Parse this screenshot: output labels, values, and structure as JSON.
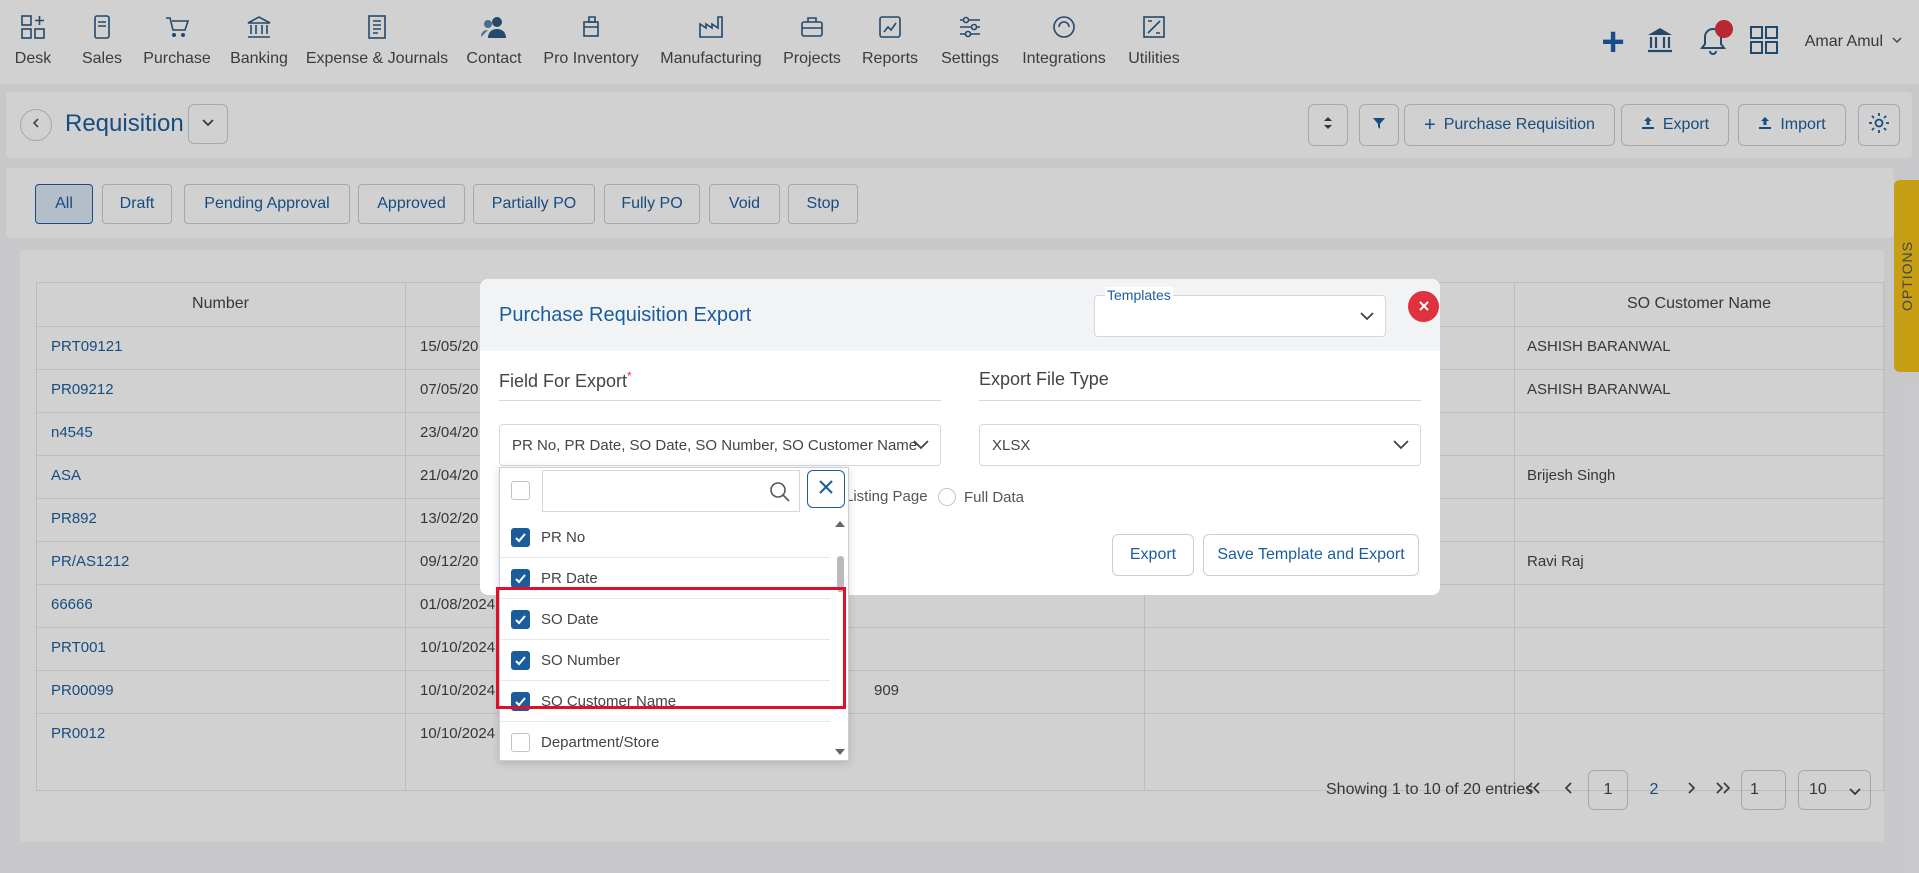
{
  "nav": {
    "items": [
      {
        "label": "Desk",
        "icon": "desk-icon"
      },
      {
        "label": "Sales",
        "icon": "sales-icon"
      },
      {
        "label": "Purchase",
        "icon": "cart-icon"
      },
      {
        "label": "Banking",
        "icon": "bank-icon"
      },
      {
        "label": "Expense & Journals",
        "icon": "journal-icon"
      },
      {
        "label": "Contact",
        "icon": "contact-icon"
      },
      {
        "label": "Pro Inventory",
        "icon": "inventory-icon"
      },
      {
        "label": "Manufacturing",
        "icon": "factory-icon"
      },
      {
        "label": "Projects",
        "icon": "briefcase-icon"
      },
      {
        "label": "Reports",
        "icon": "chart-icon"
      },
      {
        "label": "Settings",
        "icon": "sliders-icon"
      },
      {
        "label": "Integrations",
        "icon": "integrations-icon"
      },
      {
        "label": "Utilities",
        "icon": "utilities-icon"
      }
    ],
    "user_name": "Amar Amul"
  },
  "header": {
    "title": "Requisition",
    "purchase_requisition_label": "Purchase Requisition",
    "export_label": "Export",
    "import_label": "Import"
  },
  "tabs": [
    "All",
    "Draft",
    "Pending Approval",
    "Approved",
    "Partially PO",
    "Fully PO",
    "Void",
    "Stop"
  ],
  "table": {
    "headers": {
      "number": "Number",
      "so_customer_name": "SO Customer Name"
    },
    "rows": [
      {
        "number": "PRT09121",
        "date": "15/05/20",
        "mid": "",
        "customer": "ASHISH BARANWAL"
      },
      {
        "number": "PR09212",
        "date": "07/05/20",
        "mid": "",
        "customer": "ASHISH BARANWAL"
      },
      {
        "number": "n4545",
        "date": "23/04/20",
        "mid": "",
        "customer": ""
      },
      {
        "number": "ASA",
        "date": "21/04/20",
        "mid": "",
        "customer": "Brijesh Singh"
      },
      {
        "number": "PR892",
        "date": "13/02/20",
        "mid": "",
        "customer": ""
      },
      {
        "number": "PR/AS1212",
        "date": "09/12/20",
        "mid": "",
        "customer": "Ravi Raj"
      },
      {
        "number": "66666",
        "date": "01/08/2024",
        "mid": "",
        "customer": ""
      },
      {
        "number": "PRT001",
        "date": "10/10/2024",
        "mid": "",
        "customer": ""
      },
      {
        "number": "PR00099",
        "date": "10/10/2024",
        "mid": "909",
        "customer": ""
      },
      {
        "number": "PR0012",
        "date": "10/10/2024",
        "mid": "",
        "customer": ""
      }
    ]
  },
  "pagination": {
    "summary": "Showing 1 to 10 of 20 entries",
    "page1": "1",
    "page2": "2",
    "goto_value": "1",
    "page_size": "10"
  },
  "options_tab": "OPTIONS",
  "modal": {
    "title": "Purchase Requisition Export",
    "templates_label": "Templates",
    "field_for_export_label": "Field For Export",
    "required_mark": "*",
    "export_file_type_label": "Export File Type",
    "selected_fields": "PR No, PR Date, SO Date, SO Number, SO Customer Name",
    "file_type": "XLSX",
    "listing_page_label": "Listing Page",
    "full_data_label": "Full Data",
    "export_button": "Export",
    "save_template_button": "Save Template and Export"
  },
  "dropdown": {
    "search_value": "",
    "items": [
      {
        "label": "PR No",
        "checked": true
      },
      {
        "label": "PR Date",
        "checked": true
      },
      {
        "label": "SO Date",
        "checked": true
      },
      {
        "label": "SO Number",
        "checked": true
      },
      {
        "label": "SO Customer Name",
        "checked": true
      },
      {
        "label": "Department/Store",
        "checked": false
      }
    ]
  },
  "colors": {
    "accent": "#1b5d9c",
    "danger": "#e0313f",
    "options": "#f3c21a"
  }
}
